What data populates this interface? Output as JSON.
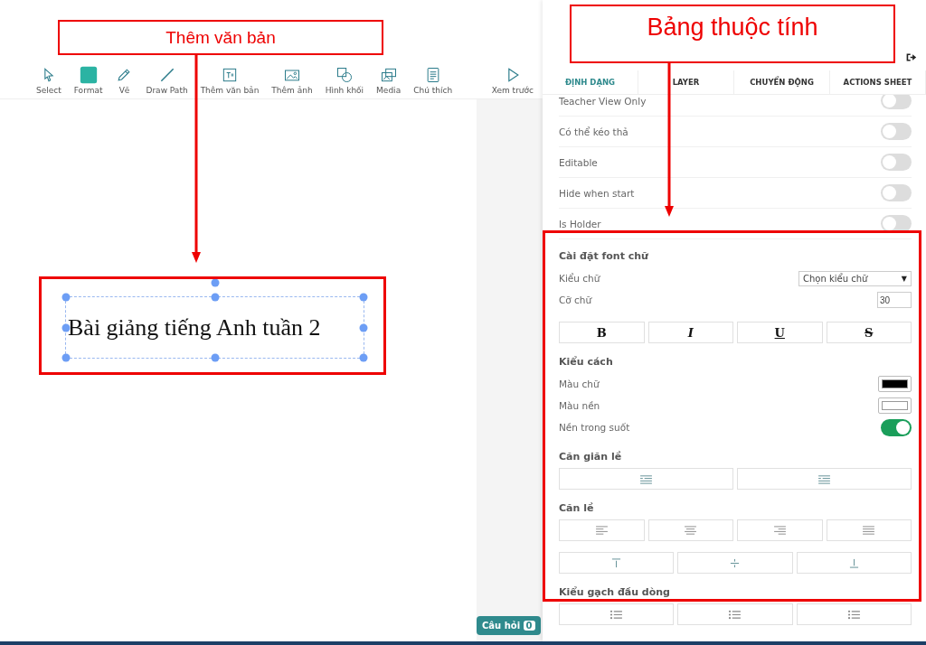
{
  "annotations": [
    {
      "label": "Thêm văn bản"
    },
    {
      "label": "Bảng thuộc tính"
    }
  ],
  "toolbar": {
    "tools": [
      {
        "label": "Select",
        "kind": "cursor"
      },
      {
        "label": "Format",
        "kind": "square"
      },
      {
        "label": "Vẽ",
        "kind": "pencil"
      },
      {
        "label": "Draw Path",
        "kind": "line"
      },
      {
        "label": "Thêm văn bản",
        "kind": "textbox"
      },
      {
        "label": "Thêm ảnh",
        "kind": "image"
      },
      {
        "label": "Hình khối",
        "kind": "shapes"
      },
      {
        "label": "Media",
        "kind": "media"
      },
      {
        "label": "Chú thích",
        "kind": "note"
      }
    ],
    "preview": {
      "label": "Xem trước"
    }
  },
  "canvas": {
    "text_box": {
      "text": "Bài giảng tiếng Anh tuần 2",
      "selected": true
    },
    "question_button": {
      "label": "Câu hỏi",
      "count": "0"
    }
  },
  "panel": {
    "tabs": [
      {
        "label": "ĐỊNH DẠNG",
        "selected": true
      },
      {
        "label": "LAYER",
        "selected": false
      },
      {
        "label": "CHUYỂN ĐỘNG",
        "selected": false
      },
      {
        "label": "ACTIONS SHEET",
        "selected": false
      }
    ],
    "toggles": [
      {
        "label": "Teacher View Only",
        "on": false
      },
      {
        "label": "Có thể kéo thả",
        "on": false
      },
      {
        "label": "Editable",
        "on": false
      },
      {
        "label": "Hide when start",
        "on": false
      },
      {
        "label": "Is Holder",
        "on": false
      }
    ],
    "font": {
      "heading": "Cài đặt font chữ",
      "font_label": "Kiểu chữ",
      "font_value": "Chọn kiểu chữ",
      "caret": "▼",
      "size_label": "Cỡ chữ",
      "size_value": "30",
      "styles": [
        {
          "label": "B",
          "kind": "bold"
        },
        {
          "label": "I",
          "kind": "italic"
        },
        {
          "label": "U",
          "kind": "underline"
        },
        {
          "label": "S",
          "kind": "strike"
        }
      ]
    },
    "style": {
      "heading": "Kiểu cách",
      "text_color": {
        "label": "Màu chữ",
        "color": "#000000"
      },
      "background_color": {
        "label": "Màu nền",
        "color": "#ffffff"
      },
      "transparent": {
        "label": "Nền trong suốt",
        "on": true
      }
    },
    "indent": {
      "heading": "Căn giãn lề"
    },
    "align": {
      "heading": "Căn lề"
    },
    "bullets": {
      "heading": "Kiểu gạch đầu dòng"
    }
  }
}
